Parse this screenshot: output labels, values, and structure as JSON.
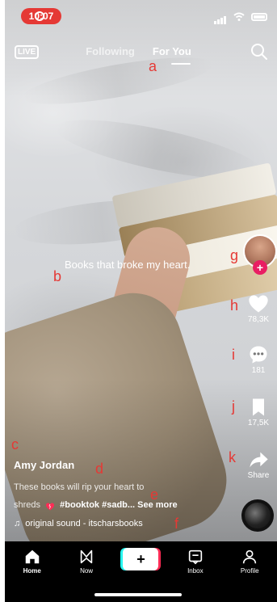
{
  "status_bar": {
    "time": "10:07"
  },
  "header": {
    "live_label": "LIVE",
    "tabs": [
      {
        "label": "Following",
        "active": false
      },
      {
        "label": "For You",
        "active": true
      }
    ]
  },
  "video": {
    "overlay_text": "Books that broke my heart."
  },
  "actions": {
    "likes": "78,3K",
    "comments": "181",
    "saves": "17,5K",
    "share_label": "Share"
  },
  "caption": {
    "username": "Amy Jordan",
    "line1": "These books will rip your heart to",
    "line2_prefix": "shreds",
    "hashtags": "#booktok #sadb...",
    "see_more": "See more",
    "sound": "original sound - itscharsbooks"
  },
  "annotations": [
    "a",
    "b",
    "c",
    "d",
    "e",
    "f",
    "g",
    "h",
    "i",
    "j",
    "k"
  ],
  "nav": {
    "items": [
      {
        "label": "Home",
        "icon": "home-icon",
        "active": true
      },
      {
        "label": "Now",
        "icon": "now-icon",
        "active": false
      },
      {
        "label": "",
        "icon": "create-icon",
        "active": false
      },
      {
        "label": "Inbox",
        "icon": "inbox-icon",
        "active": false
      },
      {
        "label": "Profile",
        "icon": "profile-icon",
        "active": false
      }
    ]
  },
  "colors": {
    "annotation": "#e53935",
    "heart": "#ff2c55",
    "tiktok_cyan": "#25f4ee",
    "tiktok_pink": "#fe2c55"
  }
}
